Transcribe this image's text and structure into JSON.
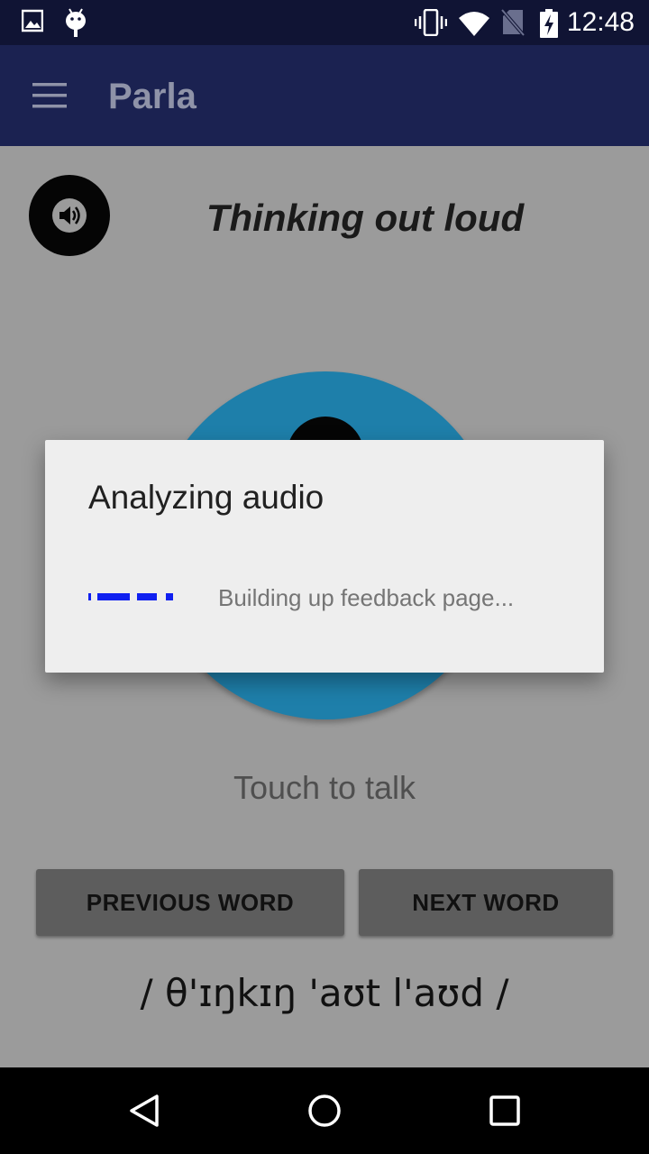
{
  "status_bar": {
    "time": "12:48",
    "icons": [
      "image-icon",
      "android-debug-icon",
      "vibrate-icon",
      "wifi-icon",
      "no-sim-icon",
      "battery-charging-icon"
    ]
  },
  "app_bar": {
    "title": "Parla",
    "menu_icon": "menu-icon"
  },
  "main": {
    "speaker_icon": "speaker-icon",
    "phrase": "Thinking out loud",
    "mic_icon": "microphone-icon",
    "touch_label": "Touch to talk",
    "previous_button": "PREVIOUS WORD",
    "next_button": "NEXT WORD",
    "ipa": "/ θ'ɪŋkɪŋ 'aʊt l'aʊd /"
  },
  "dialog": {
    "title": "Analyzing audio",
    "message": "Building up feedback page...",
    "progress_color": "#1020f0"
  },
  "nav_bar": {
    "buttons": [
      "back-icon",
      "home-icon",
      "recents-icon"
    ]
  },
  "colors": {
    "status_bar": "#101434",
    "app_bar": "#1b2251",
    "mic_accent": "#1e7faa"
  }
}
